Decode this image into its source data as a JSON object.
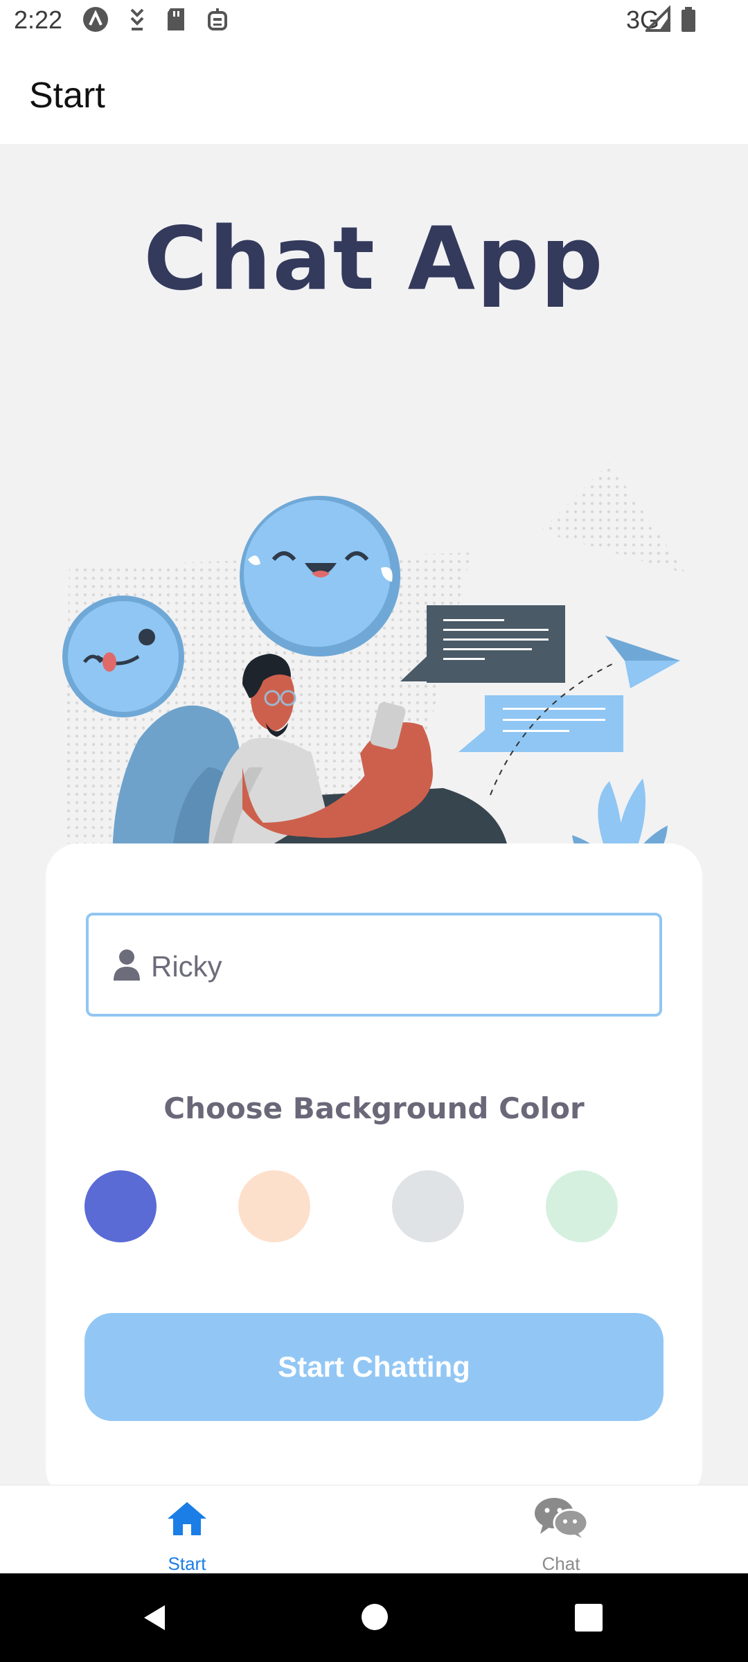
{
  "status_bar": {
    "time": "2:22",
    "network": "3G",
    "icons": [
      "app-a-icon",
      "download-icon",
      "sd-card-icon",
      "robot-icon",
      "signal-icon",
      "battery-icon"
    ]
  },
  "header": {
    "title": "Start"
  },
  "main": {
    "app_title": "Chat App",
    "name_input": {
      "value": "Ricky",
      "placeholder": "",
      "icon": "person-icon"
    },
    "color_heading": "Choose Background Color",
    "colors": [
      "#5a6bd6",
      "#fde0cc",
      "#e0e3e6",
      "#d6f0df"
    ],
    "start_button_label": "Start Chatting"
  },
  "bottom_nav": {
    "items": [
      {
        "label": "Start",
        "icon": "home-icon",
        "active": true
      },
      {
        "label": "Chat",
        "icon": "chat-bubbles-icon",
        "active": false
      }
    ]
  },
  "theme": {
    "title_color": "#343a5c",
    "accent": "#1a7ee6",
    "button_color": "#92c7f5",
    "field_border": "#90c6f3"
  }
}
